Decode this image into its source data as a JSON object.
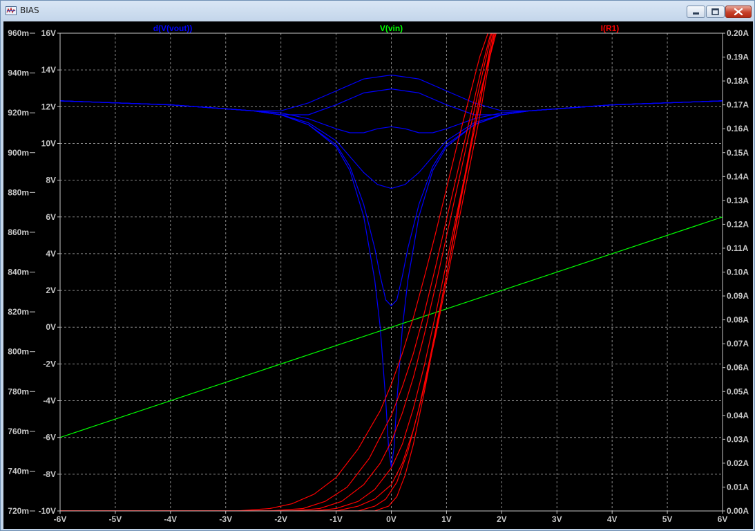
{
  "window": {
    "title": "BIAS",
    "icons": {
      "app": "waveform-window-icon",
      "minimize": "minimize-icon",
      "maximize": "maximize-icon",
      "close": "close-icon"
    }
  },
  "chart_data": {
    "type": "line",
    "grid": true,
    "background": "#000000",
    "x_axis": {
      "range": [
        -6,
        6
      ],
      "unit": "V",
      "ticks": [
        "-6V",
        "-5V",
        "-4V",
        "-3V",
        "-2V",
        "-1V",
        "0V",
        "1V",
        "2V",
        "3V",
        "4V",
        "5V",
        "6V"
      ]
    },
    "y_axes": {
      "far_left": {
        "range": [
          0.72,
          0.96
        ],
        "ticks": [
          "720m",
          "740m",
          "760m",
          "780m",
          "800m",
          "820m",
          "840m",
          "860m",
          "880m",
          "900m",
          "920m",
          "940m",
          "960m"
        ]
      },
      "left": {
        "range": [
          -10,
          16
        ],
        "ticks": [
          "-10V",
          "-8V",
          "-6V",
          "-4V",
          "-2V",
          "0V",
          "2V",
          "4V",
          "6V",
          "8V",
          "10V",
          "12V",
          "14V",
          "16V"
        ]
      },
      "right": {
        "range": [
          0.0,
          0.2
        ],
        "ticks": [
          "0.00A",
          "0.01A",
          "0.02A",
          "0.03A",
          "0.04A",
          "0.05A",
          "0.06A",
          "0.07A",
          "0.08A",
          "0.09A",
          "0.10A",
          "0.11A",
          "0.12A",
          "0.13A",
          "0.14A",
          "0.15A",
          "0.16A",
          "0.17A",
          "0.18A",
          "0.19A",
          "0.20A"
        ]
      }
    },
    "traces": [
      {
        "label": "d(V(vout))",
        "color": "#0000ff",
        "axis": "far_left",
        "series": [
          {
            "x": [
              -6,
              -4,
              -3,
              -2.5,
              -2,
              -1.5,
              -1,
              -0.5,
              0,
              0.5,
              1,
              1.5,
              2,
              2.5,
              3,
              4,
              6
            ],
            "y": [
              0.926,
              0.924,
              0.922,
              0.921,
              0.921,
              0.925,
              0.931,
              0.937,
              0.939,
              0.937,
              0.931,
              0.925,
              0.921,
              0.921,
              0.922,
              0.924,
              0.926
            ]
          },
          {
            "x": [
              -6,
              -4,
              -3,
              -2.5,
              -2,
              -1.5,
              -1,
              -0.5,
              0,
              0.5,
              1,
              1.5,
              2,
              2.5,
              3,
              4,
              6
            ],
            "y": [
              0.926,
              0.924,
              0.922,
              0.921,
              0.919,
              0.919,
              0.924,
              0.93,
              0.932,
              0.93,
              0.924,
              0.919,
              0.919,
              0.921,
              0.922,
              0.924,
              0.926
            ]
          },
          {
            "x": [
              -6,
              -4,
              -3,
              -2.5,
              -2,
              -1.5,
              -1,
              -0.75,
              -0.5,
              -0.25,
              0,
              0.25,
              0.5,
              0.75,
              1,
              1.5,
              2,
              2.5,
              3,
              4,
              6
            ],
            "y": [
              0.926,
              0.924,
              0.922,
              0.921,
              0.92,
              0.917,
              0.912,
              0.91,
              0.91,
              0.912,
              0.913,
              0.912,
              0.91,
              0.91,
              0.912,
              0.917,
              0.92,
              0.921,
              0.922,
              0.924,
              0.926
            ]
          },
          {
            "x": [
              -6,
              -4,
              -3,
              -2.5,
              -2,
              -1.5,
              -1,
              -0.75,
              -0.5,
              -0.25,
              0,
              0.25,
              0.5,
              0.75,
              1,
              1.5,
              2,
              2.5,
              3,
              4,
              6
            ],
            "y": [
              0.926,
              0.924,
              0.922,
              0.921,
              0.919,
              0.915,
              0.906,
              0.898,
              0.89,
              0.884,
              0.882,
              0.884,
              0.89,
              0.898,
              0.906,
              0.915,
              0.919,
              0.921,
              0.922,
              0.924,
              0.926
            ]
          },
          {
            "x": [
              -6,
              -4,
              -3,
              -2.5,
              -2,
              -1.5,
              -1,
              -0.75,
              -0.5,
              -0.3,
              -0.2,
              -0.1,
              0,
              0.1,
              0.2,
              0.3,
              0.5,
              0.75,
              1,
              1.5,
              2,
              2.5,
              3,
              4,
              6
            ],
            "y": [
              0.926,
              0.924,
              0.922,
              0.921,
              0.919,
              0.914,
              0.904,
              0.893,
              0.874,
              0.852,
              0.838,
              0.826,
              0.823,
              0.826,
              0.838,
              0.852,
              0.874,
              0.893,
              0.904,
              0.914,
              0.919,
              0.921,
              0.922,
              0.924,
              0.926
            ]
          },
          {
            "x": [
              -6,
              -4,
              -3,
              -2.5,
              -2,
              -1.5,
              -1,
              -0.75,
              -0.5,
              -0.3,
              -0.2,
              -0.1,
              -0.05,
              0,
              0.05,
              0.1,
              0.2,
              0.3,
              0.5,
              0.75,
              1,
              1.5,
              2,
              2.5,
              3,
              4,
              6
            ],
            "y": [
              0.926,
              0.924,
              0.922,
              0.921,
              0.919,
              0.914,
              0.903,
              0.891,
              0.868,
              0.836,
              0.812,
              0.775,
              0.752,
              0.742,
              0.752,
              0.775,
              0.812,
              0.836,
              0.868,
              0.891,
              0.903,
              0.914,
              0.919,
              0.921,
              0.922,
              0.924,
              0.926
            ]
          }
        ]
      },
      {
        "label": "V(vin)",
        "color": "#00ff00",
        "axis": "left",
        "series": [
          {
            "x": [
              -6,
              6
            ],
            "y": [
              -6,
              6
            ]
          }
        ]
      },
      {
        "label": "I(R1)",
        "color": "#ff0000",
        "axis": "right",
        "series": [
          {
            "x": [
              -6,
              -2.8,
              -2.2,
              -1.8,
              -1.4,
              -1.0,
              -0.6,
              -0.2,
              0.0,
              0.2,
              0.4,
              0.6,
              0.8,
              1.0,
              1.2,
              1.4,
              1.6,
              1.75
            ],
            "y": [
              0,
              0,
              0.001,
              0.003,
              0.007,
              0.014,
              0.026,
              0.042,
              0.053,
              0.066,
              0.081,
              0.098,
              0.116,
              0.135,
              0.154,
              0.172,
              0.19,
              0.2
            ]
          },
          {
            "x": [
              -6,
              -2.2,
              -1.6,
              -1.2,
              -0.8,
              -0.4,
              0.0,
              0.2,
              0.4,
              0.6,
              0.8,
              1.0,
              1.2,
              1.4,
              1.6,
              1.8
            ],
            "y": [
              0,
              0,
              0.001,
              0.004,
              0.01,
              0.022,
              0.04,
              0.052,
              0.066,
              0.083,
              0.102,
              0.122,
              0.142,
              0.162,
              0.182,
              0.2
            ]
          },
          {
            "x": [
              -6,
              -1.8,
              -1.3,
              -0.9,
              -0.5,
              -0.2,
              0.0,
              0.2,
              0.4,
              0.6,
              0.8,
              1.0,
              1.2,
              1.4,
              1.6,
              1.82
            ],
            "y": [
              0,
              0,
              0.001,
              0.004,
              0.011,
              0.02,
              0.029,
              0.041,
              0.056,
              0.074,
              0.094,
              0.115,
              0.136,
              0.157,
              0.178,
              0.2
            ]
          },
          {
            "x": [
              -6,
              -1.4,
              -1.0,
              -0.6,
              -0.3,
              0.0,
              0.2,
              0.4,
              0.6,
              0.8,
              1.0,
              1.2,
              1.4,
              1.6,
              1.84
            ],
            "y": [
              0,
              0,
              0.001,
              0.004,
              0.009,
              0.018,
              0.028,
              0.043,
              0.061,
              0.082,
              0.104,
              0.126,
              0.148,
              0.17,
              0.2
            ]
          },
          {
            "x": [
              -6,
              -1.0,
              -0.6,
              -0.3,
              0.0,
              0.2,
              0.4,
              0.6,
              0.8,
              1.0,
              1.2,
              1.4,
              1.6,
              1.86
            ],
            "y": [
              0,
              0,
              0.002,
              0.005,
              0.011,
              0.02,
              0.034,
              0.052,
              0.073,
              0.096,
              0.119,
              0.142,
              0.165,
              0.2
            ]
          },
          {
            "x": [
              -6,
              -0.6,
              -0.3,
              -0.1,
              0.1,
              0.3,
              0.5,
              0.7,
              0.9,
              1.1,
              1.3,
              1.5,
              1.7,
              1.88
            ],
            "y": [
              0,
              0,
              0.002,
              0.005,
              0.012,
              0.025,
              0.043,
              0.064,
              0.087,
              0.111,
              0.135,
              0.159,
              0.183,
              0.2
            ]
          },
          {
            "x": [
              -6,
              -0.3,
              -0.05,
              0.1,
              0.25,
              0.4,
              0.6,
              0.8,
              1.0,
              1.2,
              1.4,
              1.6,
              1.9
            ],
            "y": [
              0,
              0,
              0.002,
              0.006,
              0.015,
              0.028,
              0.05,
              0.074,
              0.099,
              0.124,
              0.149,
              0.174,
              0.2
            ]
          }
        ]
      }
    ]
  }
}
